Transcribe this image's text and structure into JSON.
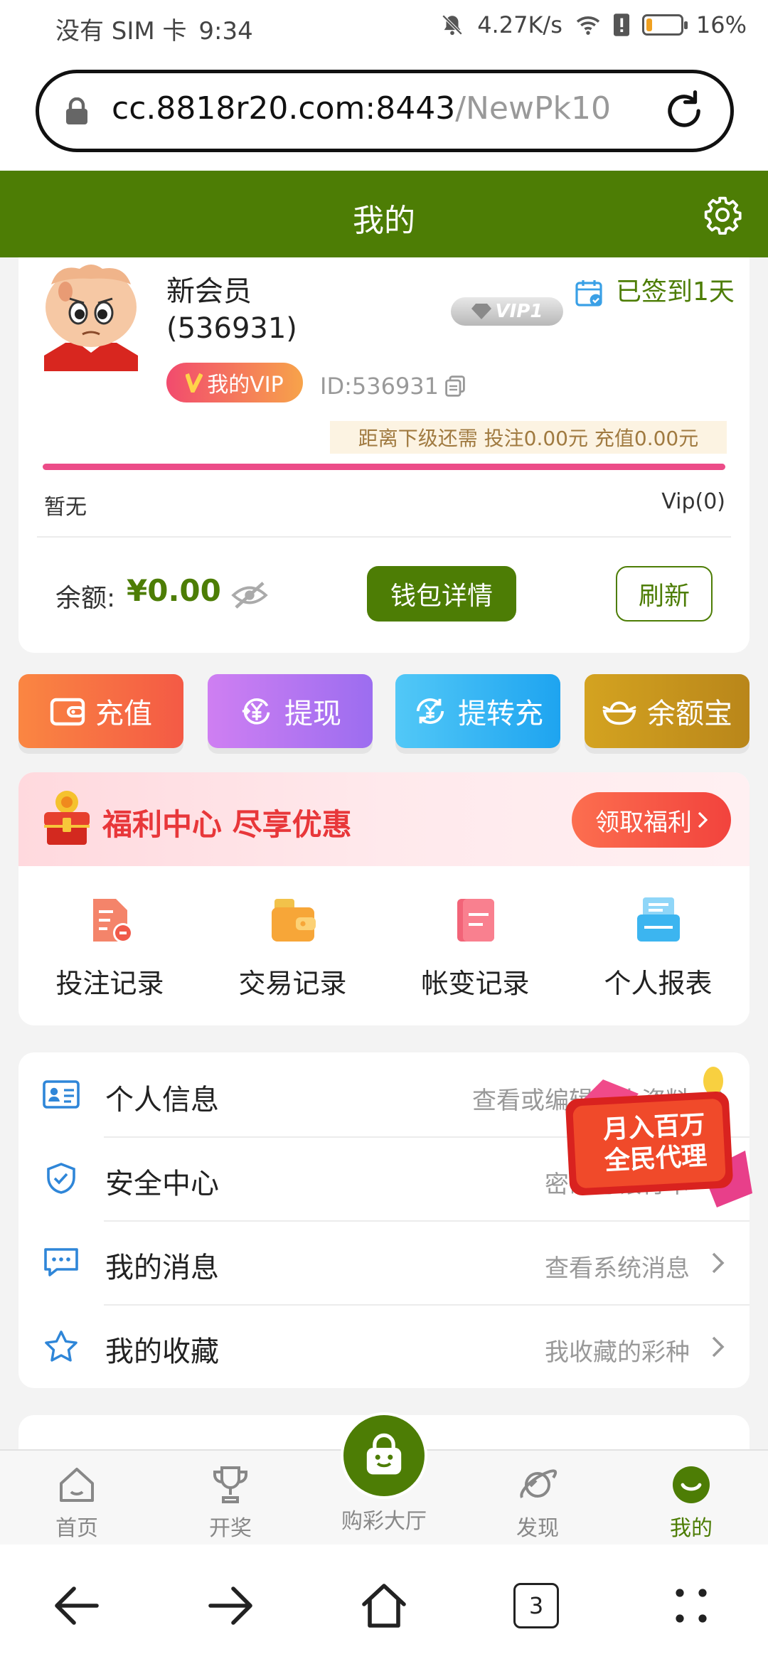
{
  "status_bar": {
    "carrier": "没有 SIM 卡",
    "time": "9:34",
    "network_speed": "4.27K/s",
    "battery": "16%",
    "battery_level": 0.16
  },
  "browser": {
    "url_host": "cc.8818r20.com:8443",
    "url_path": "/NewPk10"
  },
  "header": {
    "title": "我的"
  },
  "profile": {
    "nickname_line1": "新会员",
    "nickname_line2": "(536931)",
    "vip_badge": "VIP1",
    "signin_text": "已签到1天",
    "my_vip_label": "我的VIP",
    "user_id": "ID:536931",
    "next_level": "距离下级还需  投注0.00元  充值0.00元",
    "level_progress": 1.0,
    "level_left": "暂无",
    "level_right": "Vip(0)",
    "balance_label": "余额:",
    "balance_value": "¥0.00",
    "wallet_button": "钱包详情",
    "refresh_button": "刷新"
  },
  "actions": [
    {
      "label": "充值",
      "icon": "wallet-icon",
      "color": "#f45a45"
    },
    {
      "label": "提现",
      "icon": "yuan-cycle-icon",
      "color": "#9c6df0"
    },
    {
      "label": "提转充",
      "icon": "transfer-icon",
      "color": "#1ea4f0"
    },
    {
      "label": "余额宝",
      "icon": "ingot-icon",
      "color": "#b9861a"
    }
  ],
  "welfare": {
    "title": "福利中心 尽享优惠",
    "button": "领取福利",
    "records": [
      {
        "label": "投注记录",
        "icon": "bet-record-icon"
      },
      {
        "label": "交易记录",
        "icon": "trade-record-icon"
      },
      {
        "label": "帐变记录",
        "icon": "account-change-icon"
      },
      {
        "label": "个人报表",
        "icon": "report-icon"
      }
    ]
  },
  "menu": [
    {
      "label": "个人信息",
      "desc": "查看或编辑个人资料",
      "icon": "id-card-icon"
    },
    {
      "label": "安全中心",
      "desc": "密码与银行卡",
      "icon": "shield-icon"
    },
    {
      "label": "我的消息",
      "desc": "查看系统消息",
      "icon": "message-icon"
    },
    {
      "label": "我的收藏",
      "desc": "我收藏的彩种",
      "icon": "star-icon"
    }
  ],
  "promo_badge": {
    "line1": "月入百万",
    "line2": "全民代理"
  },
  "tabbar": [
    {
      "label": "首页",
      "icon": "home-icon"
    },
    {
      "label": "开奖",
      "icon": "trophy-icon"
    },
    {
      "label": "购彩大厅",
      "icon": "shopping-bag-icon"
    },
    {
      "label": "发现",
      "icon": "planet-icon"
    },
    {
      "label": "我的",
      "icon": "smile-icon",
      "active": true
    }
  ],
  "system_nav": {
    "tab_count": "3"
  },
  "colors": {
    "brand_green": "#4d7d05",
    "progress_pink": "#ec4c88",
    "welfare_red": "#e8373a"
  }
}
